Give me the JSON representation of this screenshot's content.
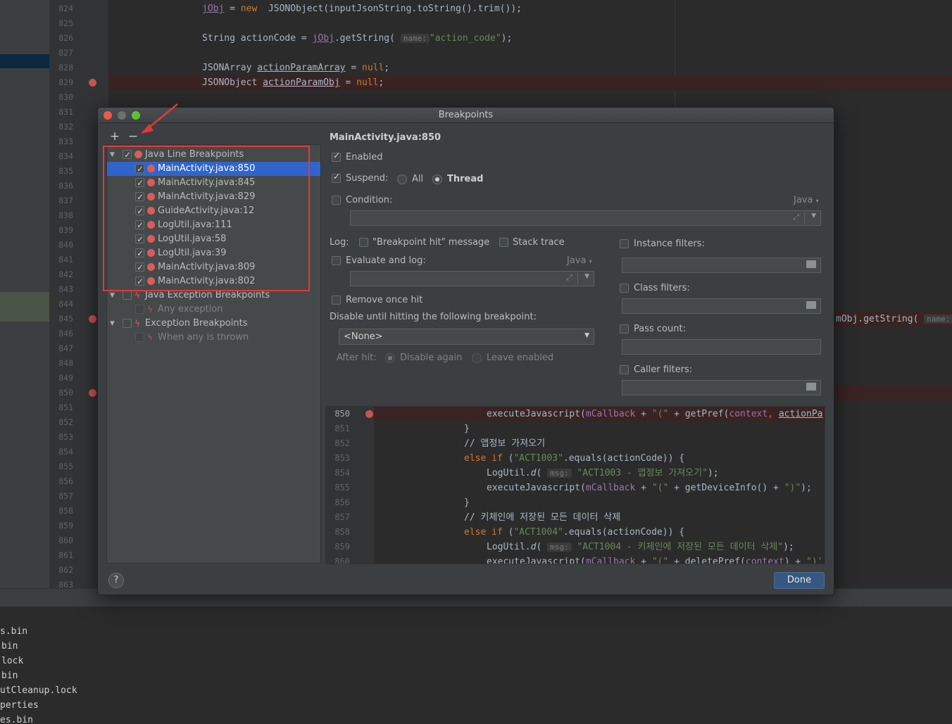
{
  "editor": {
    "gutter_lines": [
      "824",
      "825",
      "826",
      "827",
      "828",
      "829",
      "830",
      "831",
      "832",
      "833",
      "834",
      "835",
      "836",
      "837",
      "838",
      "839",
      "840",
      "841",
      "842",
      "843",
      "844",
      "845",
      "846",
      "847",
      "848",
      "849",
      "850",
      "851",
      "852",
      "853",
      "854",
      "855",
      "856",
      "857",
      "858",
      "859",
      "860",
      "861",
      "862",
      "863"
    ],
    "code": {
      "l824_a": "jObj",
      "l824_b": " = ",
      "l824_kw": "new",
      "l824_c": " JSONObject(inputJsonString.",
      "l824_d": "toString",
      "l824_e": "().trim());",
      "l826_a": "String actionCode = ",
      "l826_b": "jObj",
      "l826_c": ".getString( ",
      "l826_hint": "name:",
      "l826_str": "\"action_code\"",
      "l826_d": ");",
      "l828_a": "JSONArray ",
      "l828_b": "actionParamArray",
      "l828_c": " = ",
      "l828_kw": "null",
      "l828_d": ";",
      "l829_a": "JSONObject ",
      "l829_b": "actionParamObj",
      "l829_c": " = ",
      "l829_kw": "null",
      "l829_d": ";",
      "l845_a": "mObj.getString( ",
      "l845_hint": "name:"
    }
  },
  "bottom_files": [
    "s.bin",
    "bin",
    "lock",
    "bin",
    "utCleanup.lock",
    "perties",
    "es.bin"
  ],
  "dialog": {
    "title": "Breakpoints",
    "add_label": "+",
    "remove_label": "−",
    "tree": {
      "groups": [
        {
          "label": "Java Line Breakpoints",
          "items": [
            "MainActivity.java:850",
            "MainActivity.java:845",
            "MainActivity.java:829",
            "GuideActivity.java:12",
            "LogUtil.java:111",
            "LogUtil.java:58",
            "LogUtil.java:39",
            "MainActivity.java:809",
            "MainActivity.java:802"
          ]
        },
        {
          "label": "Java Exception Breakpoints",
          "items": [
            "Any exception"
          ]
        },
        {
          "label": "Exception Breakpoints",
          "items": [
            "When any is thrown"
          ]
        }
      ]
    },
    "details": {
      "header": "MainActivity.java:850",
      "enabled": "Enabled",
      "suspend": "Suspend:",
      "suspend_all": "All",
      "suspend_thread": "Thread",
      "condition": "Condition:",
      "lang": "Java",
      "log": "Log:",
      "log_message": "\"Breakpoint hit\" message",
      "stack_trace": "Stack trace",
      "evaluate_log": "Evaluate and log:",
      "remove_once": "Remove once hit",
      "disable_until": "Disable until hitting the following breakpoint:",
      "none_option": "<None>",
      "after_hit": "After hit:",
      "disable_again": "Disable again",
      "leave_enabled": "Leave enabled",
      "instance_filters": "Instance filters:",
      "class_filters": "Class filters:",
      "pass_count": "Pass count:",
      "caller_filters": "Caller filters:"
    },
    "preview": {
      "lines": [
        "850",
        "851",
        "852",
        "853",
        "854",
        "855",
        "856",
        "857",
        "858",
        "859",
        "860"
      ],
      "c850_a": "executeJavascript(",
      "c850_f": "mCallback",
      "c850_b": " + ",
      "c850_s": "\"(\"",
      "c850_c": " + getPref(",
      "c850_f2": "context",
      "c850_d": ", ",
      "c850_e": "actionPa",
      "c851": "}",
      "c852": "// 앱정보 가져오기",
      "c853_kw": "else if",
      "c853_a": " (",
      "c853_s": "\"ACT1003\"",
      "c853_b": ".equals(actionCode)) {",
      "c854_a": "LogUtil.",
      "c854_i": "d",
      "c854_b": "( ",
      "c854_hint": "msg:",
      "c854_s": "\"ACT1003 - 앱정보 가져오기\"",
      "c854_c": ");",
      "c855_a": "executeJavascript(",
      "c855_f": "mCallback",
      "c855_b": " + ",
      "c855_s": "\"(\"",
      "c855_c": " + getDeviceInfo() + ",
      "c855_s2": "\")\"",
      "c855_d": ");",
      "c856": "}",
      "c857": "// 키체인에 저장된 모든 데이터 삭제",
      "c858_kw": "else if",
      "c858_a": " (",
      "c858_s": "\"ACT1004\"",
      "c858_b": ".equals(actionCode)) {",
      "c859_a": "LogUtil.",
      "c859_i": "d",
      "c859_b": "( ",
      "c859_hint": "msg:",
      "c859_s": "\"ACT1004 - 키체인에 저장된 모든 데이터 삭제\"",
      "c859_c": ");",
      "c860_a": "executeJavascript(",
      "c860_f": "mCallback",
      "c860_b": " + ",
      "c860_s": "\"(\"",
      "c860_c": " + deletePref(",
      "c860_f2": "context",
      "c860_d": ") + ",
      "c860_s2": "\")'"
    },
    "help_label": "?",
    "done_label": "Done"
  }
}
